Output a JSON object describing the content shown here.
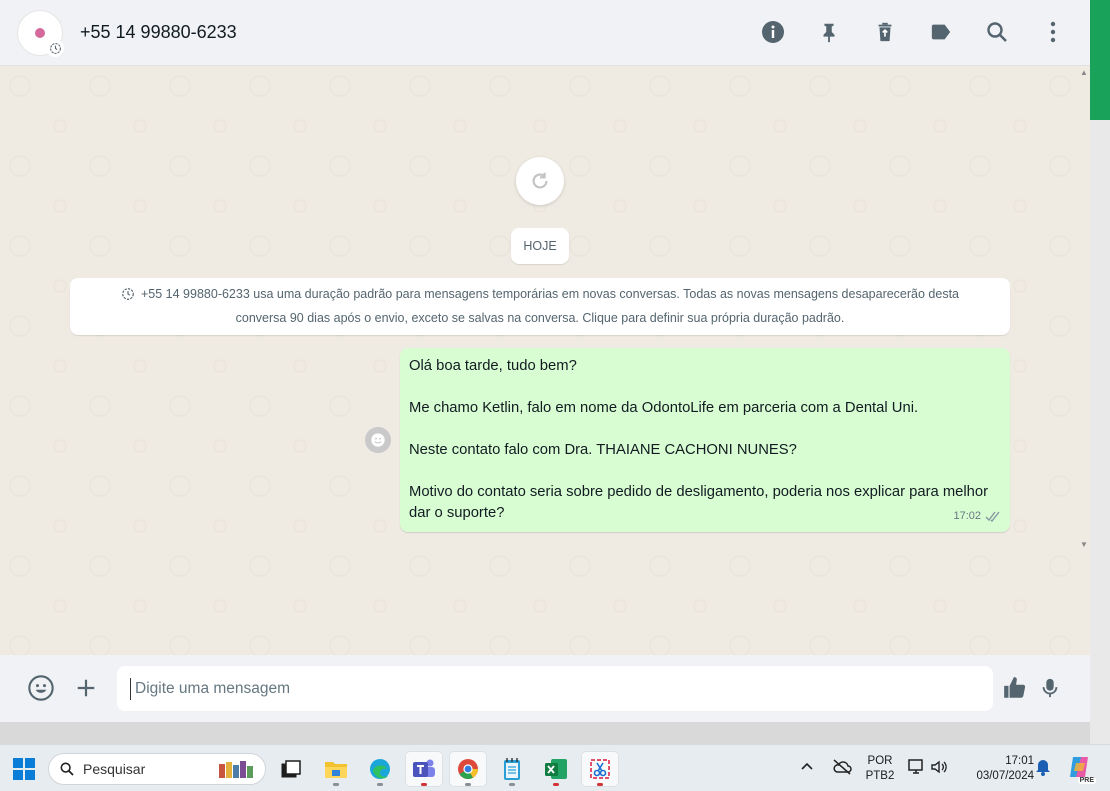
{
  "header": {
    "contact_name": "+55 14 99880-6233"
  },
  "chat": {
    "date_label": "HOJE",
    "system_message": "+55 14 99880-6233 usa uma duração padrão para mensagens temporárias em novas conversas. Todas as novas mensagens desaparecerão desta conversa 90 dias após o envio, exceto se salvas na conversa. Clique para definir sua própria duração padrão.",
    "message": {
      "lines": [
        "Olá boa tarde, tudo bem?",
        "Me chamo Ketlin, falo em nome da OdontoLife em parceria com a Dental Uni.",
        "Neste contato falo com Dra. THAIANE CACHONI NUNES?",
        "Motivo do contato seria sobre pedido de desligamento, poderia nos explicar para melhor dar o suporte?"
      ],
      "time": "17:02",
      "status": "read"
    }
  },
  "composer": {
    "placeholder": "Digite uma mensagem"
  },
  "taskbar": {
    "search_placeholder": "Pesquisar",
    "language": "POR",
    "layout": "PTB2",
    "time": "17:01",
    "date": "03/07/2024",
    "copilot_badge": "PRE"
  },
  "colors": {
    "accent": "#19a35a",
    "bubble_out": "#d9fdd3",
    "chat_bg": "#efeae2",
    "header_bg": "#f0f2f5",
    "icon": "#54656f"
  }
}
